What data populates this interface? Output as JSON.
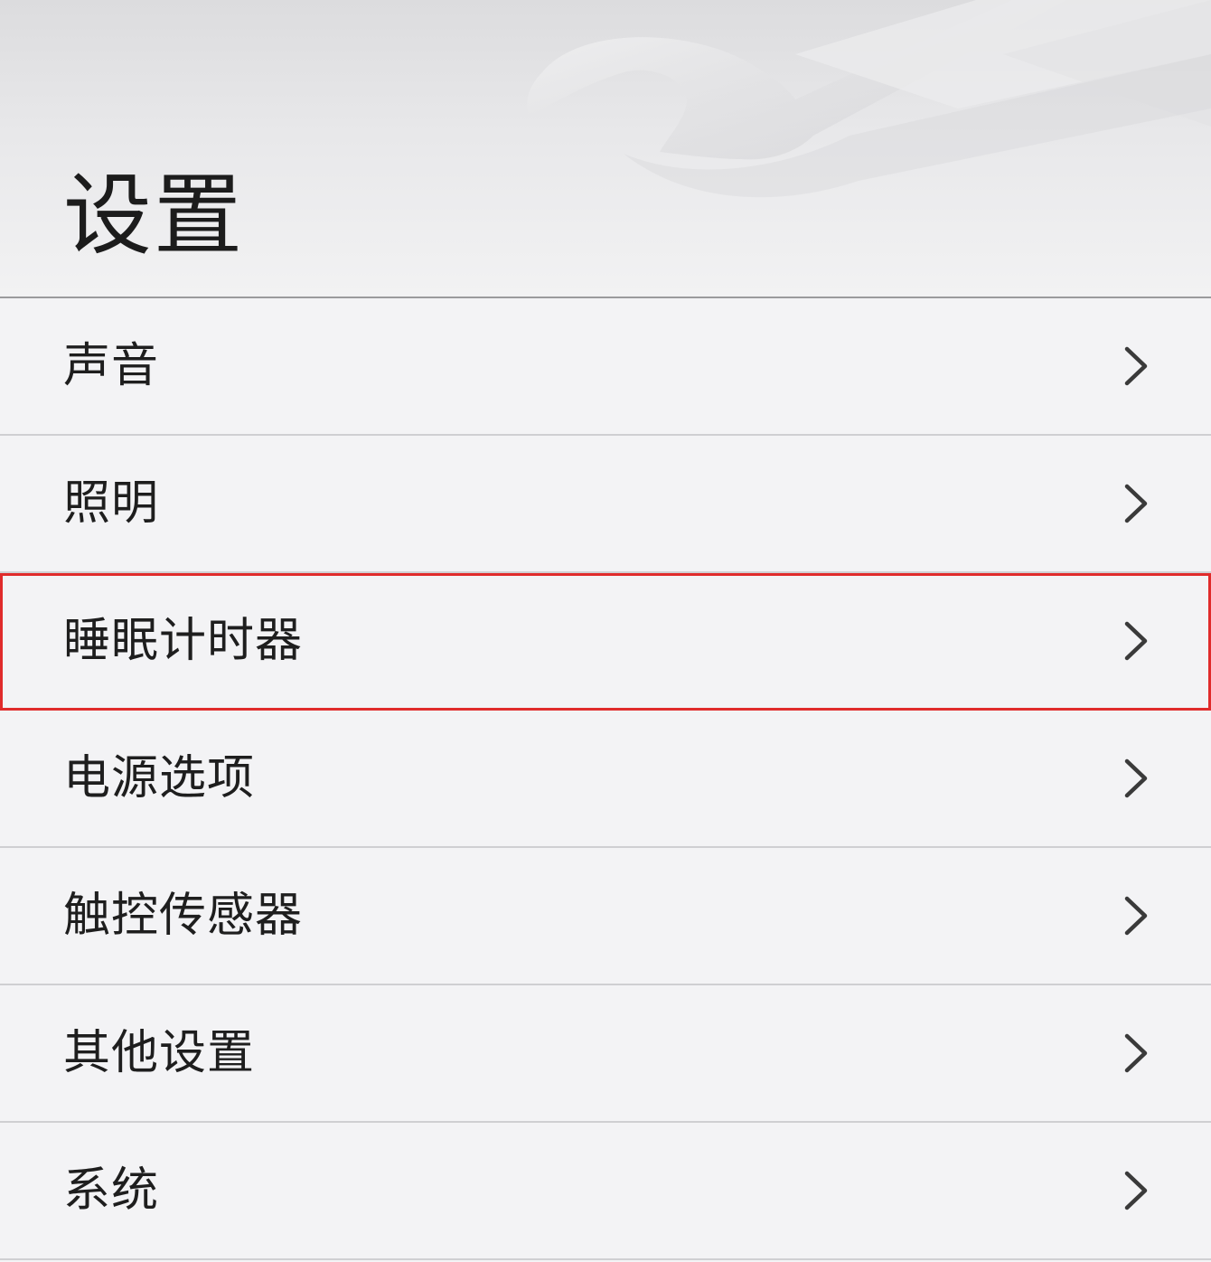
{
  "header": {
    "title": "设置",
    "background_icon": "wrench-icon"
  },
  "menu": {
    "items": [
      {
        "label": "声音",
        "icon": "chevron-right-icon",
        "highlighted": false
      },
      {
        "label": "照明",
        "icon": "chevron-right-icon",
        "highlighted": false
      },
      {
        "label": "睡眠计时器",
        "icon": "chevron-right-icon",
        "highlighted": true
      },
      {
        "label": "电源选项",
        "icon": "chevron-right-icon",
        "highlighted": false
      },
      {
        "label": "触控传感器",
        "icon": "chevron-right-icon",
        "highlighted": false
      },
      {
        "label": "其他设置",
        "icon": "chevron-right-icon",
        "highlighted": false
      },
      {
        "label": "系统",
        "icon": "chevron-right-icon",
        "highlighted": false
      }
    ]
  },
  "colors": {
    "highlight_border": "#e02b2b",
    "text": "#1e1e1e",
    "background": "#f3f3f5",
    "chevron": "#3a3a3a"
  }
}
